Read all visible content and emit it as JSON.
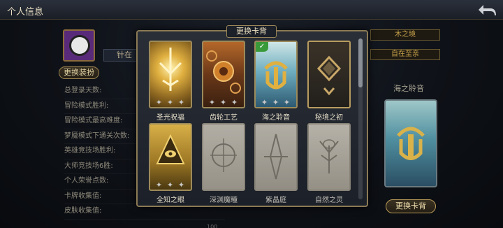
{
  "topbar": {
    "title": "个人信息",
    "back_icon": "back-arrow-icon"
  },
  "profile": {
    "name": "针在",
    "equip_button": "更换装扮",
    "stats": [
      "总登录天数:",
      "冒险模式胜利:",
      "冒险模式最高难度:",
      "梦魇模式下通关次数:",
      "英雄竞技场胜利:",
      "大师竞技场6胜:",
      "个人荣誉点数:",
      "卡牌收集值:",
      "皮肤收集值:"
    ],
    "last_value": "100",
    "tag_top": "木之境",
    "tag_second": "自在至亲",
    "side_card_label": "海之聆音",
    "change_button": "更换卡背"
  },
  "modal": {
    "title": "更换卡背",
    "cards": [
      {
        "name": "圣光祝福",
        "selected": false,
        "locked": false,
        "theme": "gold"
      },
      {
        "name": "齿轮工艺",
        "selected": false,
        "locked": false,
        "theme": "bronze"
      },
      {
        "name": "海之聆音",
        "selected": true,
        "locked": false,
        "theme": "sea"
      },
      {
        "name": "秘境之初",
        "selected": false,
        "locked": false,
        "theme": "dark"
      },
      {
        "name": "全知之眼",
        "selected": false,
        "locked": false,
        "theme": "eye"
      },
      {
        "name": "深渊魔瞳",
        "selected": false,
        "locked": true,
        "theme": "grey"
      },
      {
        "name": "紫晶庭",
        "selected": false,
        "locked": true,
        "theme": "grey"
      },
      {
        "name": "自然之灵",
        "selected": false,
        "locked": true,
        "theme": "grey"
      }
    ],
    "check_icon": "checkmark-icon",
    "star_icon": "star-icon"
  }
}
